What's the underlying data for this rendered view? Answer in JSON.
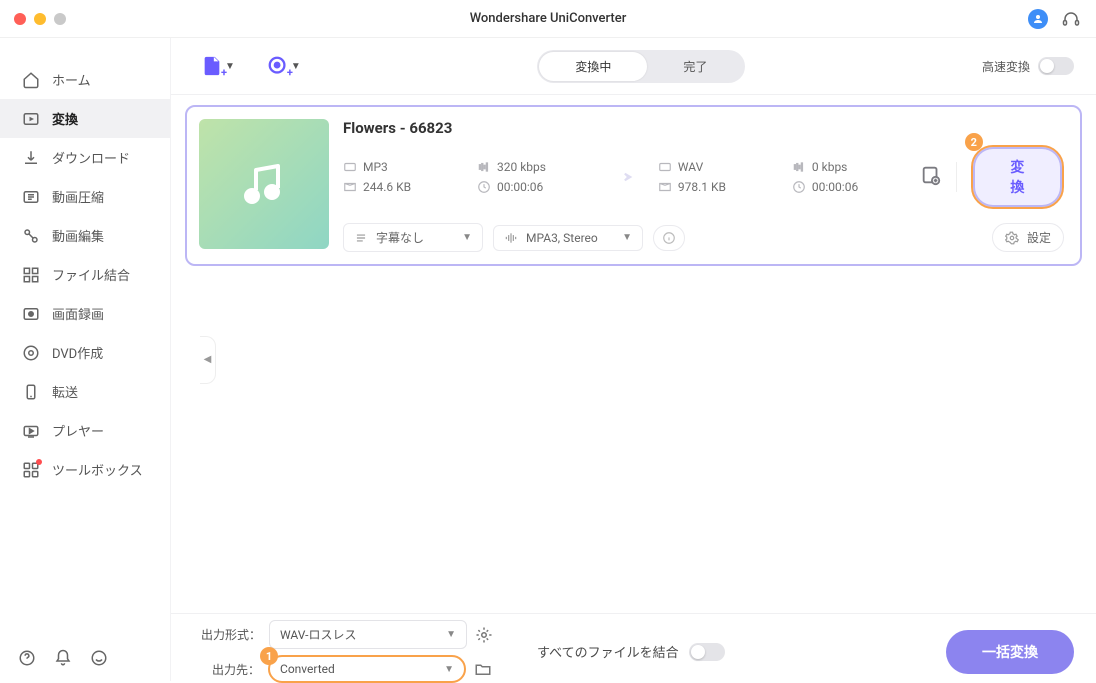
{
  "titlebar": {
    "appTitle": "Wondershare UniConverter"
  },
  "sidebar": {
    "items": [
      {
        "label": "ホーム"
      },
      {
        "label": "変換"
      },
      {
        "label": "ダウンロード"
      },
      {
        "label": "動画圧縮"
      },
      {
        "label": "動画編集"
      },
      {
        "label": "ファイル結合"
      },
      {
        "label": "画面録画"
      },
      {
        "label": "DVD作成"
      },
      {
        "label": "転送"
      },
      {
        "label": "プレヤー"
      },
      {
        "label": "ツールボックス"
      }
    ]
  },
  "toolbar": {
    "tabs": {
      "converting": "変換中",
      "done": "完了"
    },
    "fastConvert": "高速変換"
  },
  "file": {
    "title": "Flowers - 66823",
    "src": {
      "format": "MP3",
      "bitrate": "320 kbps",
      "size": "244.6 KB",
      "duration": "00:00:06"
    },
    "dst": {
      "format": "WAV",
      "bitrate": "0 kbps",
      "size": "978.1 KB",
      "duration": "00:00:06"
    },
    "subtitle": "字幕なし",
    "audioTrack": "MPA3, Stereo",
    "settingsLabel": "設定",
    "convertLabel": "変換",
    "badge2": "2"
  },
  "bottom": {
    "outFormatLabel": "出力形式：",
    "outFormatValue": "WAV-ロスレス",
    "outDirLabel": "出力先：",
    "outDirValue": "Converted",
    "mergeAll": "すべてのファイルを結合",
    "batch": "一括変換",
    "badge1": "1"
  }
}
